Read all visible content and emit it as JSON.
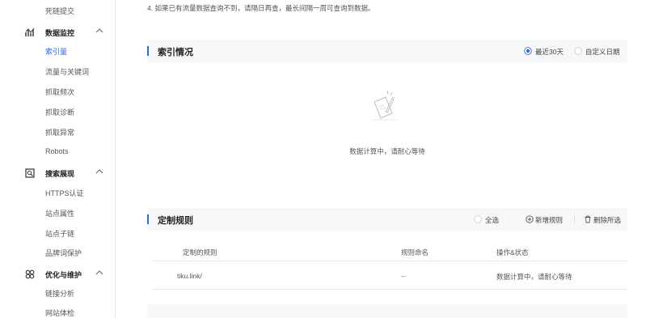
{
  "sidebar": {
    "top_item": "死链提交",
    "groups": [
      {
        "label": "数据监控",
        "icon": "chart-icon",
        "items": [
          "索引量",
          "流量与关键词",
          "抓取频次",
          "抓取诊断",
          "抓取异常",
          "Robots"
        ]
      },
      {
        "label": "搜索展现",
        "icon": "search-display-icon",
        "items": [
          "HTTPS认证",
          "站点属性",
          "站点子链",
          "品牌词保护"
        ]
      },
      {
        "label": "优化与维护",
        "icon": "optimize-icon",
        "items": [
          "链接分析",
          "网站体检"
        ]
      }
    ],
    "active_item": "索引量",
    "accent": "#2e6bd9"
  },
  "main": {
    "tip": "4. 如果已有流量数据查询不到，请隔日再查，最长间隔一周可查询到数据。",
    "index_panel": {
      "title": "索引情况",
      "range_options": [
        "最近30天",
        "自定义日期"
      ],
      "selected_range": "最近30天",
      "empty_text": "数据计算中，请耐心等待"
    },
    "rules_panel": {
      "title": "定制规则",
      "select_all": "全选",
      "add_rule": "新增规则",
      "delete_selected": "删除所选",
      "columns": [
        "定制的规则",
        "规则命名",
        "操作&状态"
      ],
      "rows": [
        {
          "rule": "tiku.link/",
          "name": "--",
          "status": "数据计算中，请耐心等待"
        }
      ]
    }
  }
}
